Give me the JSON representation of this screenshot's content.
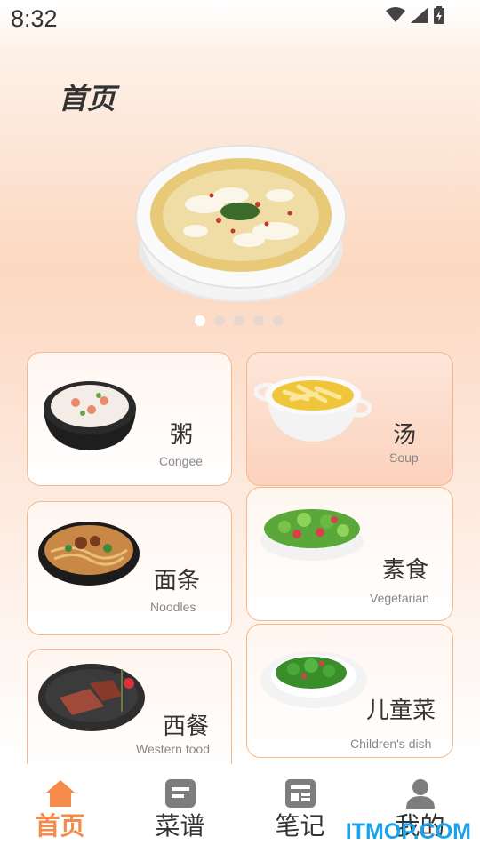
{
  "status_bar": {
    "time": "8:32"
  },
  "header": {
    "title": "首页"
  },
  "banner": {
    "slide_count": 5,
    "active_index": 0
  },
  "categories": [
    {
      "zh": "粥",
      "en": "Congee"
    },
    {
      "zh": "汤",
      "en": "Soup"
    },
    {
      "zh": "面条",
      "en": "Noodles"
    },
    {
      "zh": "素食",
      "en": "Vegetarian"
    },
    {
      "zh": "西餐",
      "en": "Western food"
    },
    {
      "zh": "儿童菜",
      "en": "Children's dish"
    }
  ],
  "tabbar": {
    "items": [
      {
        "label": "首页",
        "icon": "home-icon",
        "active": true
      },
      {
        "label": "菜谱",
        "icon": "recipe-icon",
        "active": false
      },
      {
        "label": "笔记",
        "icon": "notes-icon",
        "active": false
      },
      {
        "label": "我的",
        "icon": "profile-icon",
        "active": false
      }
    ]
  },
  "colors": {
    "accent": "#f58a4a",
    "card_border": "#f5b98d",
    "watermark": "#1aa3e8"
  },
  "watermark": "ITMOP.COM"
}
